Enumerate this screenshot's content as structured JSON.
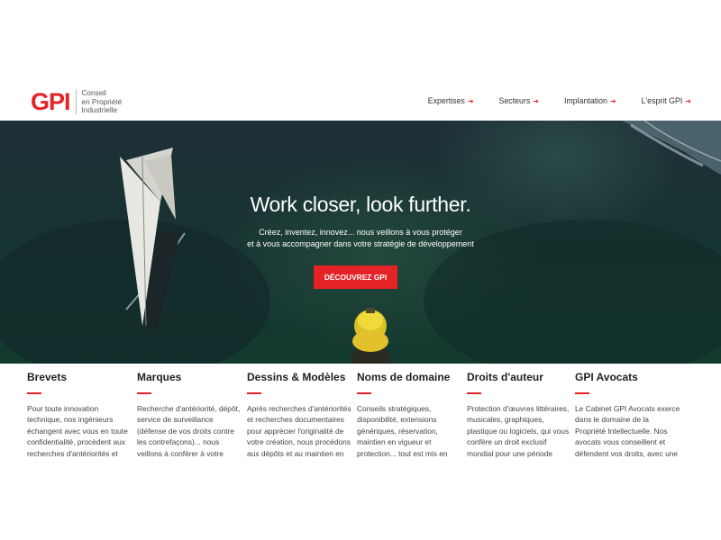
{
  "header": {
    "logo": "GPI",
    "logo_lines": [
      "Conseil",
      "en Propriété",
      "Industrielle"
    ],
    "nav": [
      {
        "label": "Expertises"
      },
      {
        "label": "Secteurs"
      },
      {
        "label": "Implantation"
      },
      {
        "label": "L'esprit GPI"
      }
    ],
    "nav_arrow": "➔"
  },
  "hero": {
    "title": "Work closer, look further.",
    "subtitle_line1": "Créez, inventez, innovez... nous veillons à vous protéger",
    "subtitle_line2": "et à vous accompagner dans votre stratégie de développement",
    "button": "DÉCOUVREZ GPI"
  },
  "columns": [
    {
      "title": "Brevets",
      "text": "Pour toute innovation technique, nos ingénieurs échangent avec vous en toute confidentialité, procèdent aux recherches d'antériorités et"
    },
    {
      "title": "Marques",
      "text": "Recherche d'antériorité, dépôt, service de surveillance (défense de vos droits contre les contrefaçons)... nous veillons à conférer à votre marque un"
    },
    {
      "title": "Dessins & Modèles",
      "text": "Après recherches d'antériorités et recherches documentaires pour apprécier l'originalité de votre création, nous procédons aux dépôts et au maintien en"
    },
    {
      "title": "Noms de domaine",
      "text": "Conseils stratégiques, disponibilité, extensions génériques, réservation, maintien en vigueur et protection... tout est mis en"
    },
    {
      "title": "Droits d'auteur",
      "text": "Protection d'œuvres littéraires, musicales, graphiques, plastique ou logiciels, qui vous confère un droit exclusif mondial pour une période"
    },
    {
      "title": "GPI Avocats",
      "text": "Le Cabinet GPI Avocats exerce dans le domaine de la Propriété Intellectuelle. Nos avocats vous conseillent et défendent vos droits, avec une parfaite"
    }
  ],
  "colors": {
    "accent": "#e52326"
  }
}
